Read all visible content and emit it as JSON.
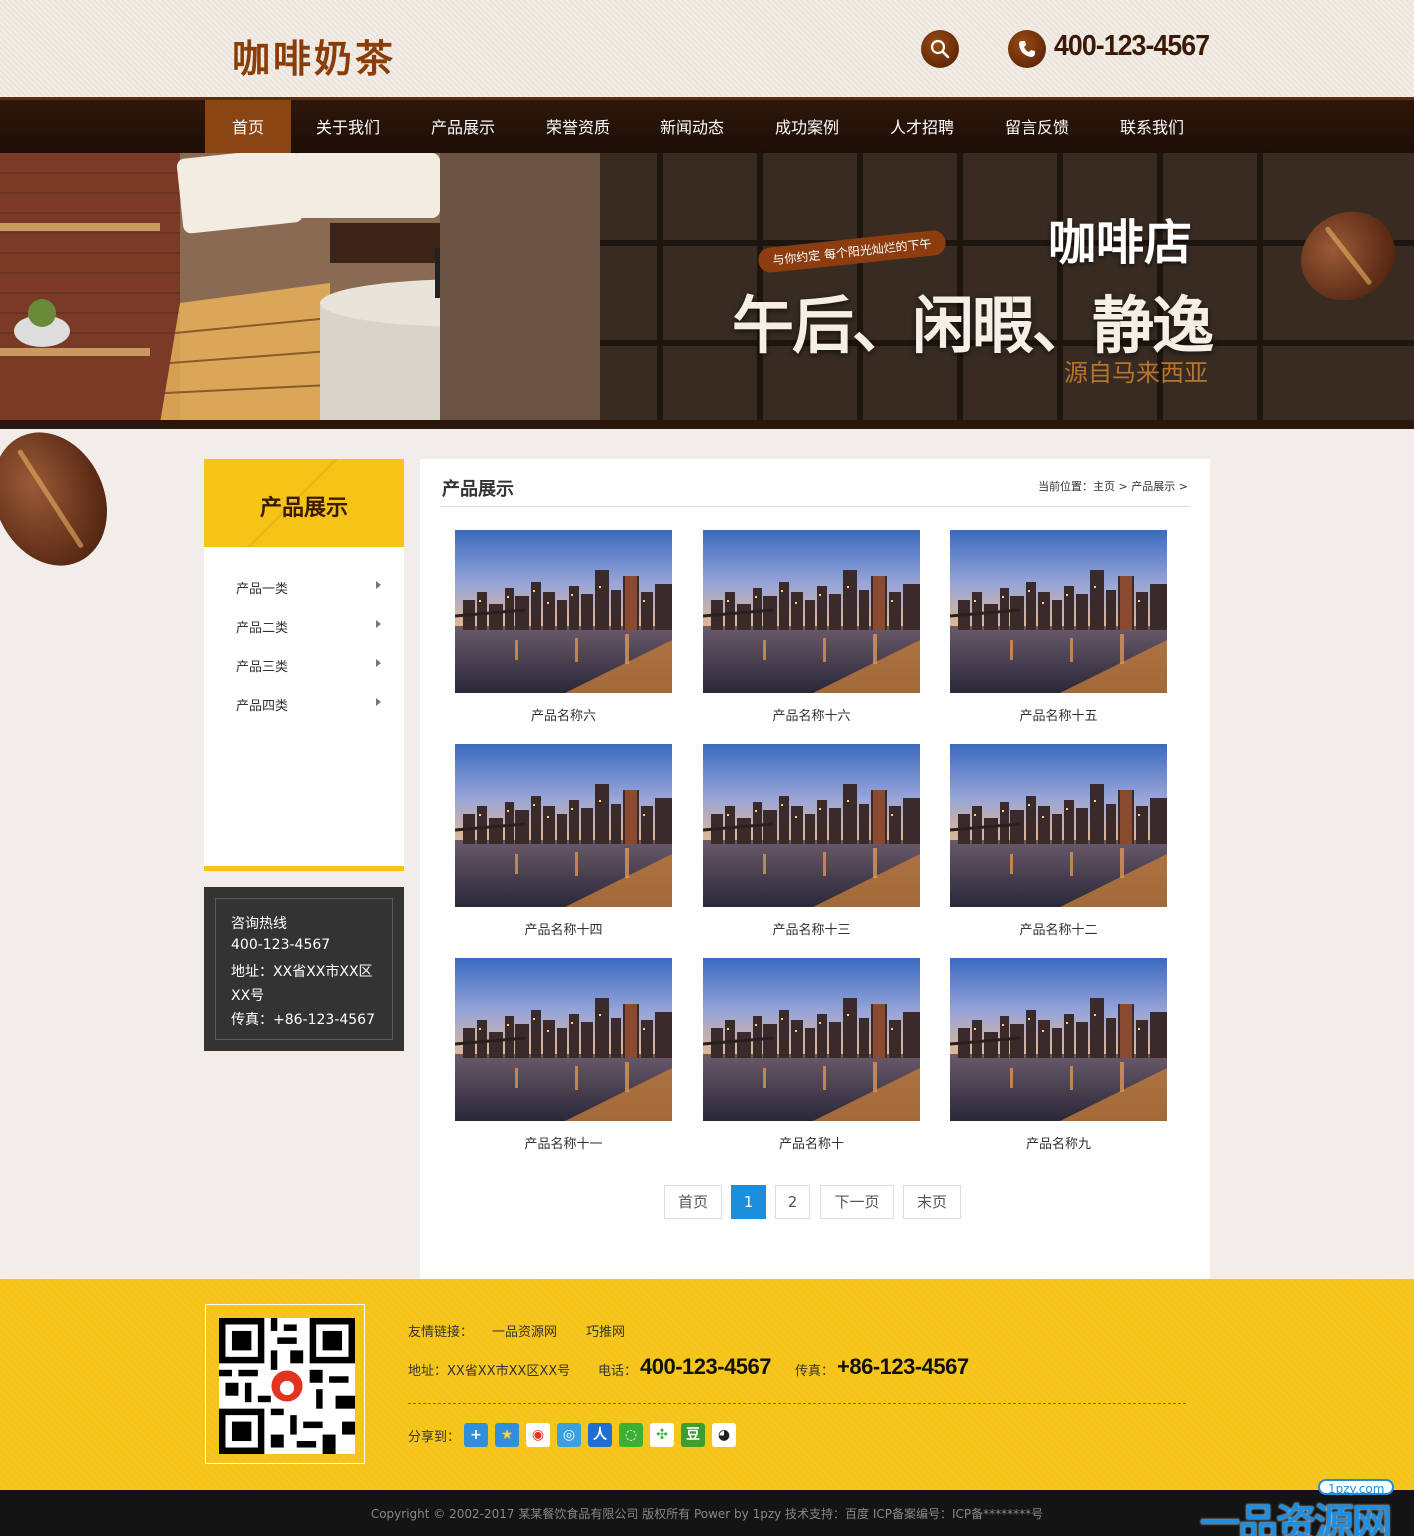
{
  "header": {
    "logo_text": "咖啡奶茶",
    "phone": "400-123-4567"
  },
  "nav": {
    "items": [
      {
        "label": "首页",
        "active": true
      },
      {
        "label": "关于我们"
      },
      {
        "label": "产品展示"
      },
      {
        "label": "荣誉资质"
      },
      {
        "label": "新闻动态"
      },
      {
        "label": "成功案例"
      },
      {
        "label": "人才招聘"
      },
      {
        "label": "留言反馈"
      },
      {
        "label": "联系我们"
      }
    ]
  },
  "banner": {
    "ribbon": "与你约定 每个阳光灿烂的下午",
    "title_small": "咖啡店",
    "title_big": "午后、闲暇、静逸",
    "subtitle": "源自马来西亚"
  },
  "sidebar": {
    "title": "产品展示",
    "items": [
      {
        "label": "产品一类"
      },
      {
        "label": "产品二类"
      },
      {
        "label": "产品三类"
      },
      {
        "label": "产品四类"
      }
    ]
  },
  "contact": {
    "hotline_label": "咨询热线",
    "hotline": "400-123-4567",
    "address_line1": "地址：XX省XX市XX区",
    "address_line2": "XX号",
    "fax": "传真：+86-123-4567"
  },
  "content": {
    "title": "产品展示",
    "breadcrumb": "当前位置：主页 > 产品展示 >",
    "products": [
      {
        "name": "产品名称六"
      },
      {
        "name": "产品名称十六"
      },
      {
        "name": "产品名称十五"
      },
      {
        "name": "产品名称十四"
      },
      {
        "name": "产品名称十三"
      },
      {
        "name": "产品名称十二"
      },
      {
        "name": "产品名称十一"
      },
      {
        "name": "产品名称十"
      },
      {
        "name": "产品名称九"
      }
    ],
    "pagination": {
      "first": "首页",
      "pages": [
        "1",
        "2"
      ],
      "current": "1",
      "next": "下一页",
      "last": "末页"
    }
  },
  "footer": {
    "links_label": "友情链接：",
    "links": [
      "一品资源网",
      "巧推网"
    ],
    "address": "地址：XX省XX市XX区XX号",
    "phone_label": "电话：",
    "phone": "400-123-4567",
    "fax_label": "传真：",
    "fax": "+86-123-4567",
    "share_label": "分享到：",
    "share_icons": [
      "more-icon",
      "qzone-icon",
      "weibo-icon",
      "tencent-weibo-icon",
      "renren-icon",
      "wechat-icon",
      "kaixin-icon",
      "douban-icon",
      "qq-icon"
    ],
    "copyright": "Copyright © 2002-2017 某某餐饮食品有限公司 版权所有 Power by 1pzy    技术支持：百度    ICP备案编号：ICP备********号"
  },
  "watermark": {
    "domain": "1pzy.com",
    "text": "一品资源网"
  },
  "colors": {
    "brand_brown": "#8a3d08",
    "nav_active": "#8b4513",
    "yellow": "#f6c416",
    "pager_active": "#1b8fdc"
  }
}
